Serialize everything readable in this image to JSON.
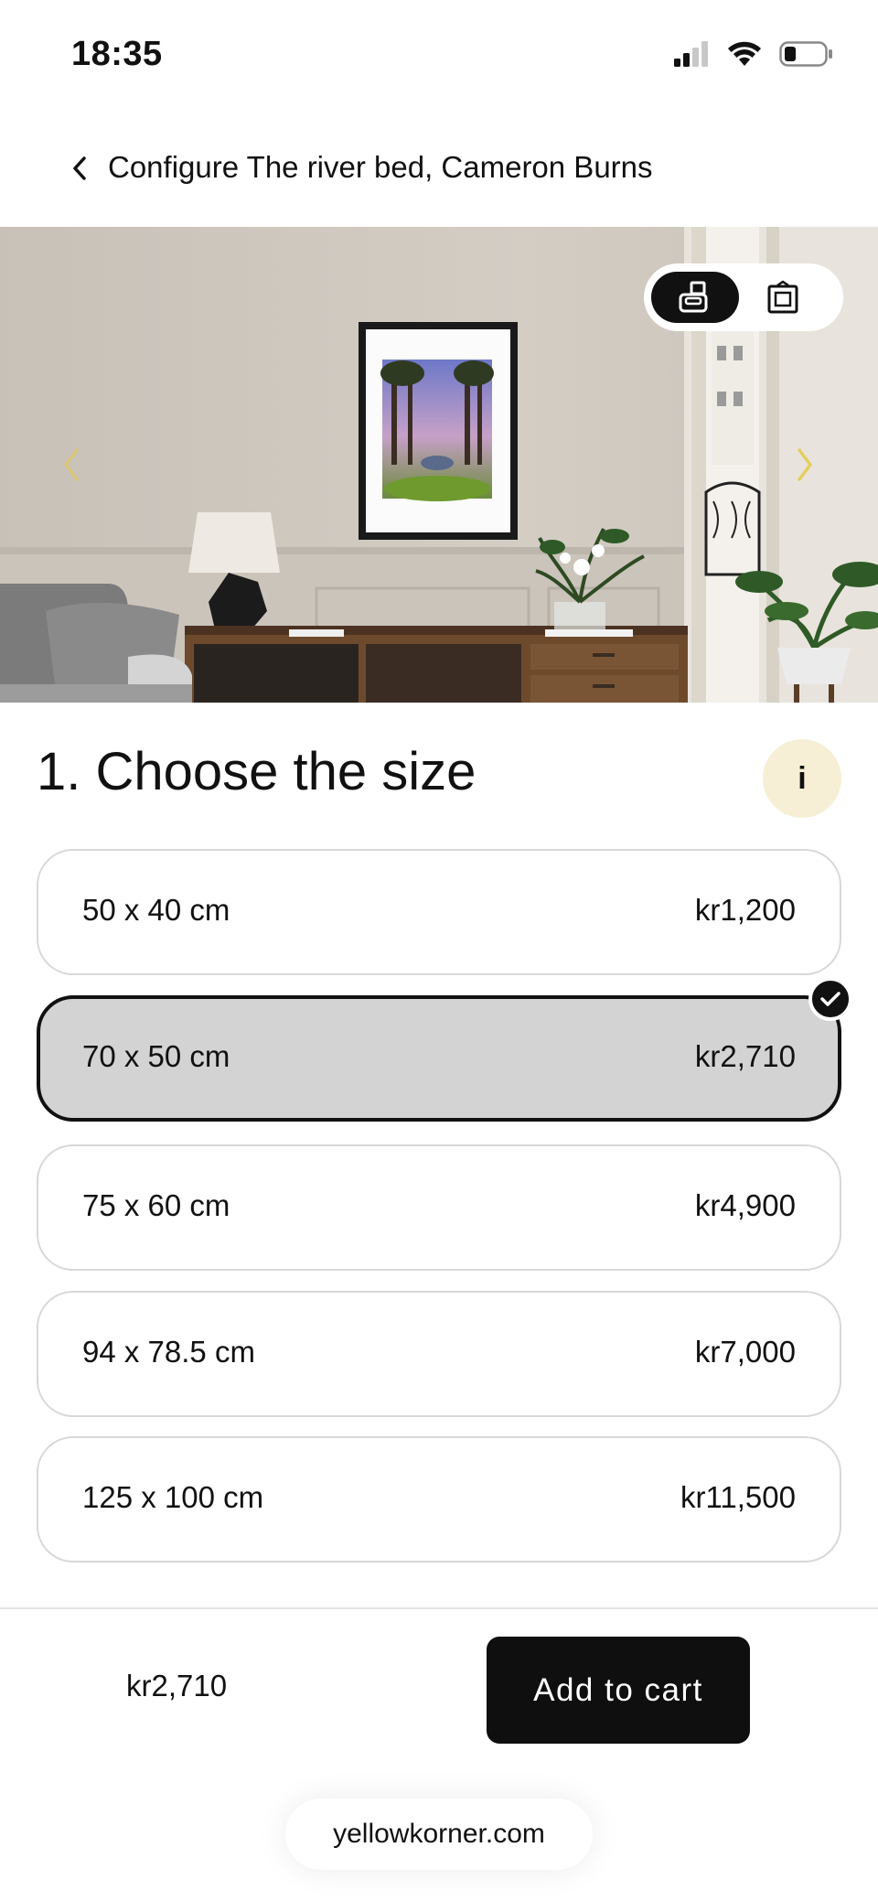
{
  "status_bar": {
    "time": "18:35",
    "icons": [
      "cellular-signal-icon",
      "wifi-icon",
      "battery-icon"
    ]
  },
  "header": {
    "back_icon": "chevron-left-icon",
    "title": "Configure The river bed, Cameron Burns"
  },
  "hero": {
    "view_toggle": {
      "options": [
        {
          "icon": "room-view-icon",
          "active": true
        },
        {
          "icon": "frame-view-icon",
          "active": false
        }
      ]
    },
    "prev_icon": "chevron-left-icon",
    "next_icon": "chevron-right-icon"
  },
  "size_section": {
    "title": "1. Choose the size",
    "info_label": "i",
    "options": [
      {
        "size": "50 x 40 cm",
        "price": "kr1,200",
        "selected": false
      },
      {
        "size": "70 x 50 cm",
        "price": "kr2,710",
        "selected": true
      },
      {
        "size": "75 x 60 cm",
        "price": "kr4,900",
        "selected": false
      },
      {
        "size": "94 x 78.5 cm",
        "price": "kr7,000",
        "selected": false
      },
      {
        "size": "125 x 100 cm",
        "price": "kr11,500",
        "selected": false
      }
    ]
  },
  "footer": {
    "total": "kr2,710",
    "add_to_cart": "Add to cart"
  },
  "browser": {
    "url": "yellowkorner.com"
  },
  "colors": {
    "accent_dark": "#111111",
    "selected_bg": "#d3d3d3",
    "info_bg": "#f6efd6",
    "arrow_color": "#d9c77a"
  }
}
